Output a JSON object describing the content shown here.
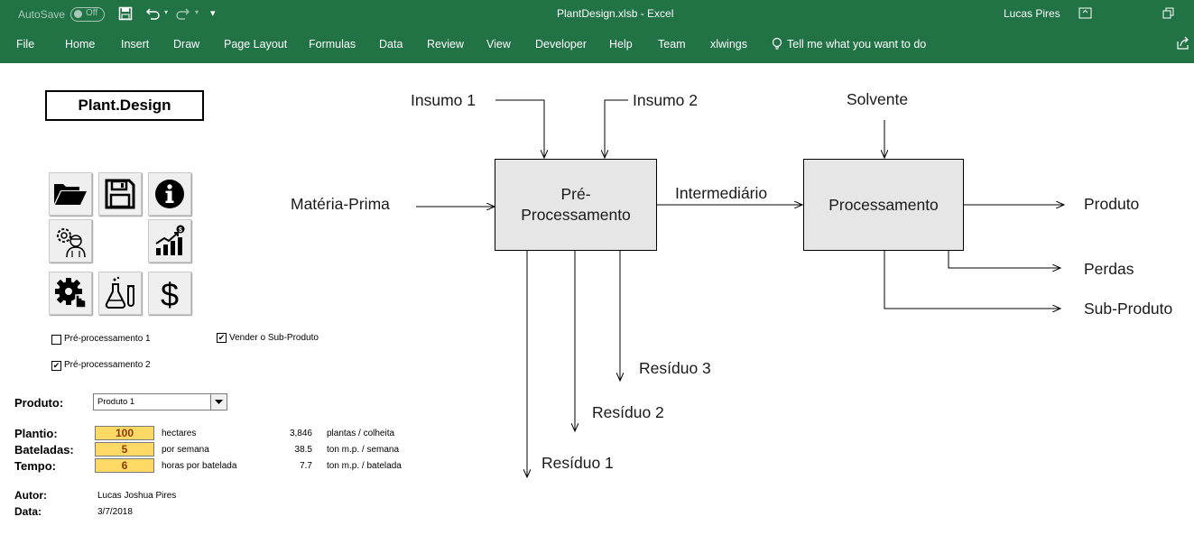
{
  "titlebar": {
    "autosave_label": "AutoSave",
    "autosave_state": "Off",
    "file_title": "PlantDesign.xlsb  -  Excel",
    "user": "Lucas Pires"
  },
  "menu": {
    "items": [
      "File",
      "Home",
      "Insert",
      "Draw",
      "Page Layout",
      "Formulas",
      "Data",
      "Review",
      "View",
      "Developer",
      "Help",
      "Team",
      "xlwings"
    ],
    "tell_me": "Tell me what you want to do"
  },
  "sheet": {
    "logo": "Plant.Design",
    "icons": [
      "folder-open-icon",
      "save-icon",
      "info-icon",
      "gear-person-icon",
      "growth-chart-icon",
      "settings-click-icon",
      "lab-flask-icon",
      "dollar-icon"
    ],
    "checkboxes": {
      "pre1": {
        "label": "Pré-processamento 1",
        "checked": false
      },
      "pre2": {
        "label": "Pré-processamento 2",
        "checked": true
      },
      "sell": {
        "label": "Vender o Sub-Produto",
        "checked": true
      }
    },
    "produto_label": "Produto:",
    "produto_value": "Produto 1",
    "plantio_label": "Plantio:",
    "plantio_value": "100",
    "plantio_unit": "hectares",
    "plantio_calc": "3,846",
    "plantio_calc_unit": "plantas / colheita",
    "bateladas_label": "Bateladas:",
    "bateladas_value": "5",
    "bateladas_unit": "por semana",
    "bateladas_calc": "38.5",
    "bateladas_calc_unit": "ton m.p. / semana",
    "tempo_label": "Tempo:",
    "tempo_value": "6",
    "tempo_unit": "horas por batelada",
    "tempo_calc": "7.7",
    "tempo_calc_unit": "ton m.p. / batelada",
    "autor_label": "Autor:",
    "autor_value": "Lucas Joshua Pires",
    "data_label": "Data:",
    "data_value": "3/7/2018"
  },
  "diagram": {
    "insumo1": "Insumo 1",
    "insumo2": "Insumo 2",
    "solvente": "Solvente",
    "materia_prima": "Matéria-Prima",
    "pre_proc_1": "Pré-",
    "pre_proc_2": "Processamento",
    "intermediario": "Intermediário",
    "processamento": "Processamento",
    "produto": "Produto",
    "perdas": "Perdas",
    "sub_produto": "Sub-Produto",
    "residuo1": "Resíduo 1",
    "residuo2": "Resíduo 2",
    "residuo3": "Resíduo 3"
  },
  "colors": {
    "ribbon": "#217346",
    "input_cell": "#ffd965",
    "process_box": "#e6e6e6"
  }
}
